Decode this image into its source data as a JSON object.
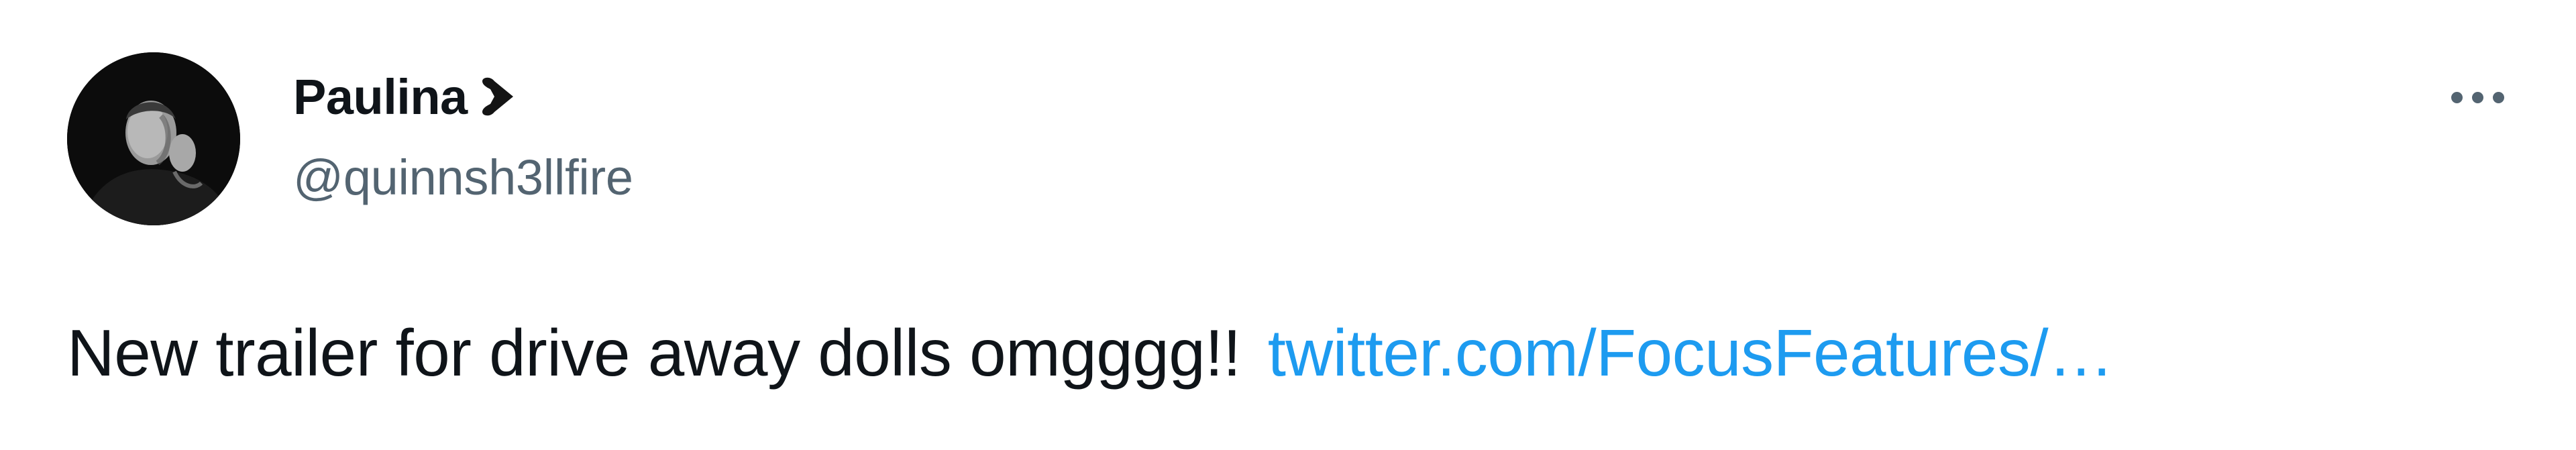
{
  "author": {
    "display_name": "Paulina",
    "name_emoji": "black-heart-on-side",
    "handle": "@quinnsh3llfire",
    "avatar": "person-portrait-black-and-white"
  },
  "tweet": {
    "text": "New trailer for drive away dolls omgggg!!",
    "link_text": "twitter.com/FocusFeatures/…"
  },
  "actions": {
    "more_icon": "more-dots-icon"
  },
  "colors": {
    "text_primary": "#0f1419",
    "text_secondary": "#536471",
    "link": "#1d9bf0",
    "background": "#ffffff"
  }
}
